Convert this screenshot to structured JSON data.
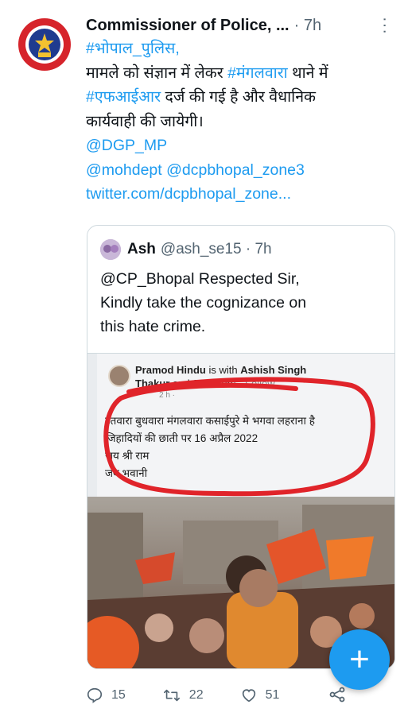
{
  "tweet": {
    "author": "Commissioner of Police, ...",
    "time": "· 7h",
    "body_lines": [
      {
        "segments": [
          {
            "text": "#भोपाल_पुलिस,",
            "link": true
          }
        ]
      },
      {
        "segments": [
          {
            "text": "मामले को संज्ञान में लेकर ",
            "link": false
          },
          {
            "text": "#मंगलवारा",
            "link": true
          },
          {
            "text": " थाने में",
            "link": false
          }
        ]
      },
      {
        "segments": [
          {
            "text": "#एफआईआर",
            "link": true
          },
          {
            "text": " दर्ज की गई है और वैधानिक",
            "link": false
          }
        ]
      },
      {
        "segments": [
          {
            "text": "कार्यवाही की जायेगी।",
            "link": false
          }
        ]
      },
      {
        "segments": [
          {
            "text": "@DGP_MP",
            "link": true
          }
        ]
      },
      {
        "segments": [
          {
            "text": "@mohdept @dcpbhopal_zone3",
            "link": true
          }
        ]
      },
      {
        "segments": [
          {
            "text": " twitter.com/dcpbhopal_zone...",
            "link": true
          }
        ]
      }
    ],
    "counts": {
      "replies": "15",
      "retweets": "22",
      "likes": "51"
    }
  },
  "quote": {
    "name": "Ash",
    "handle": "@ash_se15 · 7h",
    "text_lines": [
      "@CP_Bhopal Respected Sir,",
      "Kindly take the cognizance on",
      "this hate crime."
    ],
    "fb_post": {
      "author": "Pramod Hindu",
      "with_text": " is with ",
      "tagged": "Ashish Singh",
      "tagged_line2": "Thakur",
      "others": " and 28 others",
      "follow": " · Follow",
      "time": "2 h ·",
      "lines": [
        "इतवारा बुधवारा मंगलवारा कसाईपुरे मे भगवा लहराना है",
        "जिहादियों की छाती पर 16 अप्रैल 2022",
        "जय श्री राम",
        "जय भवानी"
      ]
    }
  },
  "fab_label": "+",
  "colors": {
    "link": "#1d9bf0",
    "muted": "#536471",
    "scribble": "#e0242a"
  }
}
